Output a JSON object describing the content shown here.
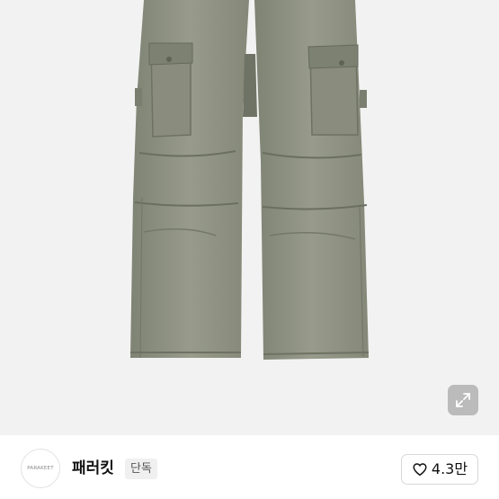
{
  "product": {
    "image_alt": "olive cargo pants product photo",
    "expand_icon": "expand-icon"
  },
  "brand": {
    "logo_text": "PARAKEET",
    "name": "패러킷",
    "badge": "단독"
  },
  "like": {
    "icon": "heart-icon",
    "count": "4.3만"
  },
  "colors": {
    "image_background": "#f2f2f2",
    "pants": "#8f9282",
    "badge_background": "#f0f0f0"
  }
}
